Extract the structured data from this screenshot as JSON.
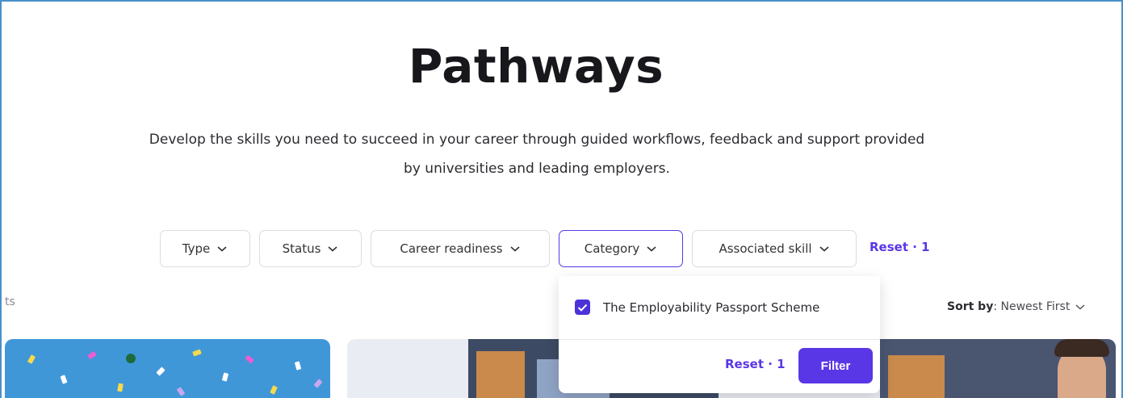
{
  "page": {
    "title": "Pathways",
    "subtitle_line1": "Develop the skills you need to succeed in your career through guided workflows, feedback and support provided",
    "subtitle_line2": "by universities and leading employers."
  },
  "filters": {
    "type": "Type",
    "status": "Status",
    "career_readiness": "Career readiness",
    "category": "Category",
    "associated_skill": "Associated skill",
    "reset": "Reset · 1"
  },
  "results_fragment": "ts",
  "sort": {
    "label": "Sort by",
    "value": ": Newest First"
  },
  "category_dropdown": {
    "option": "The Employability Passport Scheme",
    "option_checked": true,
    "reset": "Reset · 1",
    "filter_button": "Filter"
  },
  "colors": {
    "accent": "#5a37e6",
    "checkbox": "#4b33d8",
    "card_blue": "#3f97d8"
  }
}
